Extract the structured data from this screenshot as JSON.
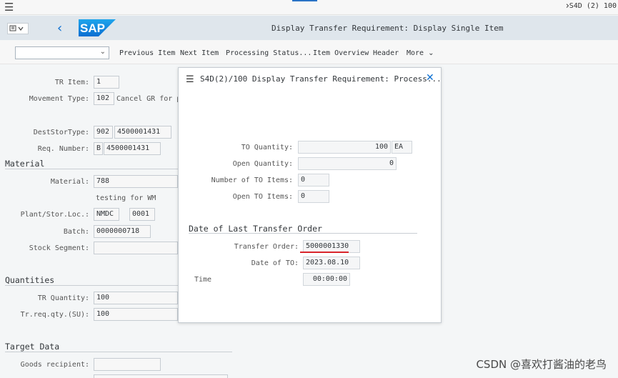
{
  "os": {
    "right_text": "S4D (2) 100"
  },
  "shell": {
    "title": "Display Transfer Requirement: Display Single Item",
    "logo": "SAP"
  },
  "toolbar": {
    "dropdown_value": "",
    "items": [
      "Previous Item",
      "Next Item",
      "Processing Status...",
      "Item Overview",
      "Header",
      "More"
    ]
  },
  "form": {
    "tr_item": {
      "label": "TR Item:",
      "value": "1"
    },
    "movement_type": {
      "label": "Movement Type:",
      "value": "102",
      "desc": "Cancel GR for pur"
    },
    "dest_stor_type": {
      "label": "DestStorType:",
      "value": "902",
      "value2": "4500001431"
    },
    "req_number": {
      "label": "Req. Number:",
      "value": "B",
      "value2": "4500001431"
    },
    "material_section": "Material",
    "material": {
      "label": "Material:",
      "value": "788",
      "desc": "testing for WM"
    },
    "plant": {
      "label": "Plant/Stor.Loc.:",
      "value": "NMDC",
      "value2": "0001"
    },
    "batch": {
      "label": "Batch:",
      "value": "0000000718"
    },
    "stock_segment": {
      "label": "Stock Segment:",
      "value": ""
    },
    "quantities_section": "Quantities",
    "tr_quantity": {
      "label": "TR Quantity:",
      "value": "100"
    },
    "tr_req_qty": {
      "label": "Tr.req.qty.(SU):",
      "value": "100"
    },
    "target_section": "Target Data",
    "goods_recipient": {
      "label": "Goods recipient:",
      "value": ""
    }
  },
  "dialog": {
    "title": "S4D(2)/100 Display Transfer Requirement: Process...",
    "to_quantity": {
      "label": "TO Quantity:",
      "value": "100",
      "unit": "EA"
    },
    "open_quantity": {
      "label": "Open Quantity:",
      "value": "0"
    },
    "num_to_items": {
      "label": "Number of TO Items:",
      "value": "0"
    },
    "open_to_items": {
      "label": "Open TO Items:",
      "value": "0"
    },
    "section": "Date of Last Transfer Order",
    "transfer_order": {
      "label": "Transfer Order:",
      "value": "5000001330"
    },
    "date_of_to": {
      "label": "Date of TO:",
      "value": "2023.08.10"
    },
    "time": {
      "label": "Time",
      "value": "00:00:00"
    }
  },
  "watermark": "CSDN @喜欢打酱油的老鸟",
  "colors": {
    "accent": "#0a6ed1",
    "underline": "#d9262c"
  }
}
